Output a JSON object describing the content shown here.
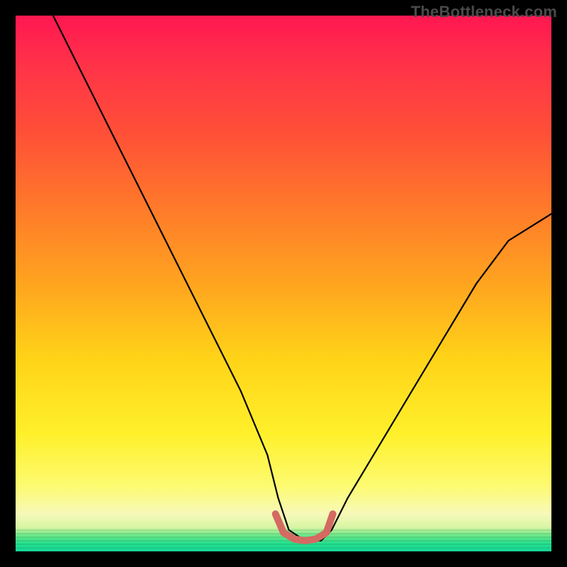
{
  "watermark": {
    "text": "TheBottleneck.com"
  },
  "chart_data": {
    "type": "line",
    "title": "",
    "xlabel": "",
    "ylabel": "",
    "xlim": [
      0,
      100
    ],
    "ylim": [
      0,
      100
    ],
    "grid": false,
    "legend": false,
    "series": [
      {
        "name": "bottleneck-curve",
        "color": "#000000",
        "x": [
          7,
          12,
          17,
          22,
          27,
          32,
          37,
          42,
          47,
          49,
          51,
          54,
          57,
          59,
          62,
          68,
          74,
          80,
          86,
          92,
          100
        ],
        "values": [
          100,
          90,
          80,
          70,
          60,
          50,
          40,
          30,
          18,
          10,
          4,
          2,
          2,
          4,
          10,
          20,
          30,
          40,
          50,
          58,
          63
        ]
      },
      {
        "name": "optimal-zone-marker",
        "color": "#d46a62",
        "x": [
          48.5,
          50,
          52,
          54,
          56,
          58,
          59.2
        ],
        "values": [
          7.0,
          3.5,
          2.3,
          2.0,
          2.3,
          3.5,
          7.0
        ]
      }
    ],
    "gradient_stops": [
      {
        "pct": 0,
        "color": "#ff1751"
      },
      {
        "pct": 22,
        "color": "#ff5037"
      },
      {
        "pct": 50,
        "color": "#ffa41f"
      },
      {
        "pct": 78,
        "color": "#fff02a"
      },
      {
        "pct": 93,
        "color": "#f7f9b9"
      },
      {
        "pct": 100,
        "color": "#16d99a"
      }
    ]
  }
}
